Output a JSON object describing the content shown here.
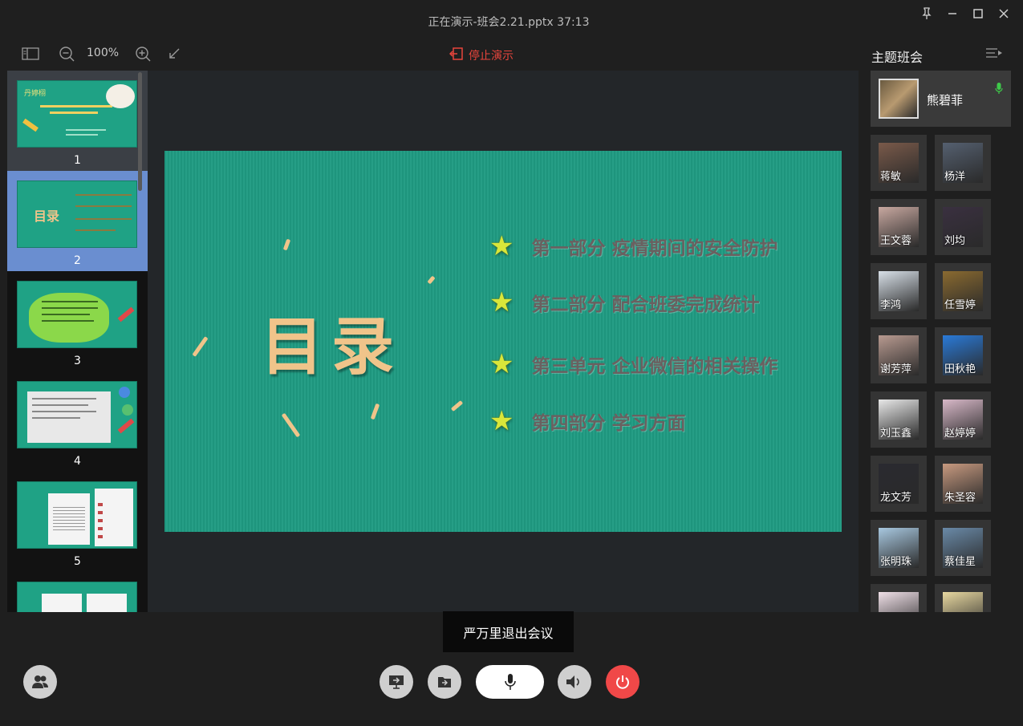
{
  "window": {
    "title": "正在演示-班会2.21.pptx 37:13"
  },
  "toolbar": {
    "zoom": "100%",
    "stop_label": "停止演示"
  },
  "thumbnails": [
    {
      "num": "1",
      "text": "丹婷栩"
    },
    {
      "num": "2",
      "text": "目录"
    },
    {
      "num": "3",
      "text": ""
    },
    {
      "num": "4",
      "text": ""
    },
    {
      "num": "5",
      "text": ""
    }
  ],
  "slide": {
    "title": "目录",
    "items": [
      "第一部分  疫情期间的安全防护",
      "第二部分  配合班委完成统计",
      "第三单元  企业微信的相关操作",
      "第四部分  学习方面"
    ]
  },
  "panel": {
    "title": "主题班会",
    "host": {
      "name": "熊碧菲"
    },
    "participants": [
      {
        "name": "蒋敏",
        "color": "#7a5a4a"
      },
      {
        "name": "杨洋",
        "color": "#556070"
      },
      {
        "name": "王文蓉",
        "color": "#c8a8a0"
      },
      {
        "name": "刘均",
        "color": "#3a3040"
      },
      {
        "name": "李鸿",
        "color": "#d8e0e8"
      },
      {
        "name": "任雪婷",
        "color": "#8a6a30"
      },
      {
        "name": "谢芳萍",
        "color": "#b89a90"
      },
      {
        "name": "田秋艳",
        "color": "#2a7ad8"
      },
      {
        "name": "刘玉鑫",
        "color": "#e8e8e8"
      },
      {
        "name": "赵婷婷",
        "color": "#d8b8c8"
      },
      {
        "name": "龙文芳",
        "color": "#2a2a30"
      },
      {
        "name": "朱圣容",
        "color": "#c89a80"
      },
      {
        "name": "张明珠",
        "color": "#a8c8e0"
      },
      {
        "name": "蔡佳星",
        "color": "#6a8aa8"
      },
      {
        "name": "",
        "color": "#f0e0e8"
      },
      {
        "name": "",
        "color": "#e8d8a0"
      }
    ]
  },
  "toast": "严万里退出会议",
  "colors": {
    "accent_red": "#e8453c",
    "mic_active": "#3ec94a",
    "power": "#f04848"
  }
}
